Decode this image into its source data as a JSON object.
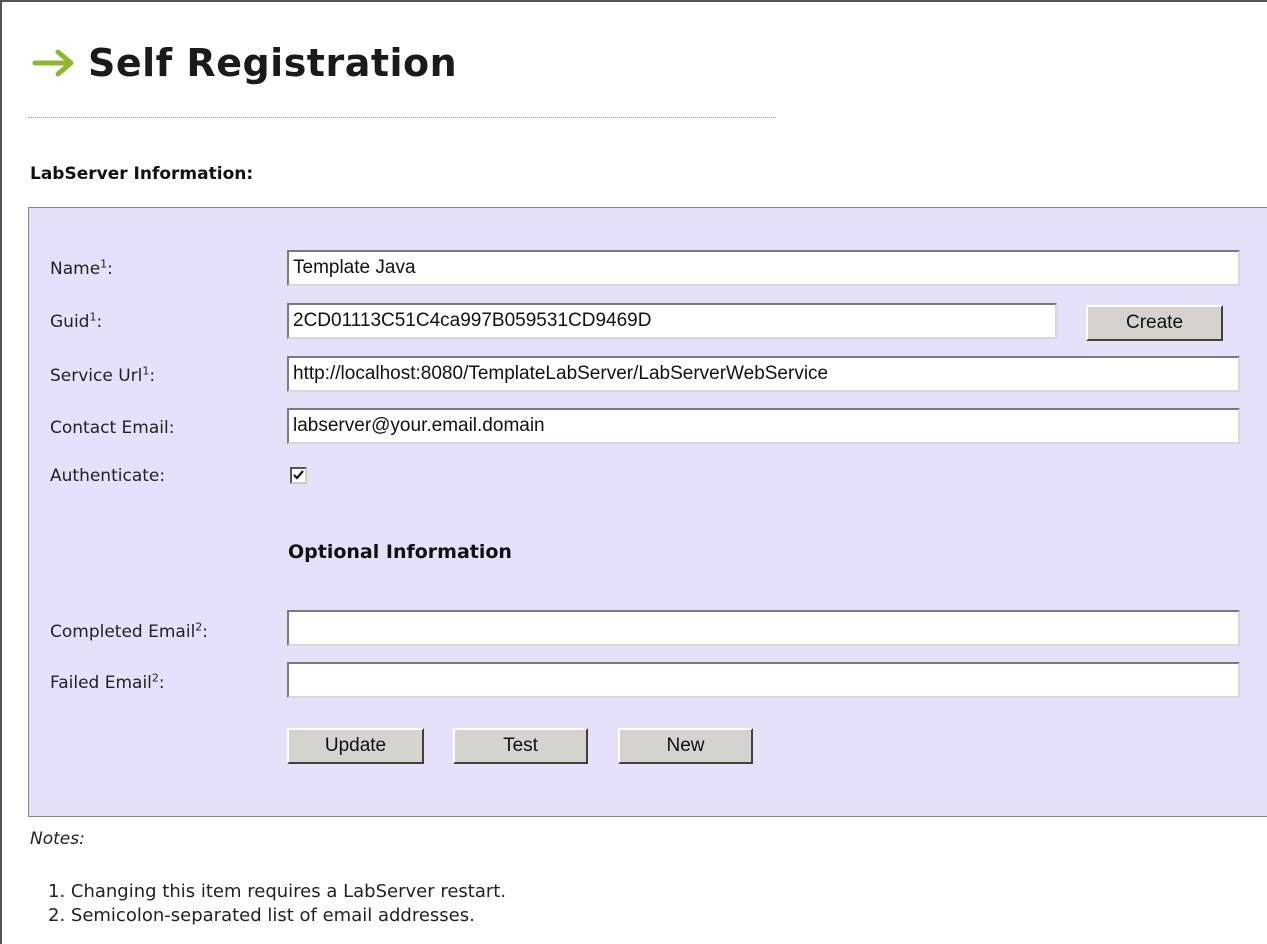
{
  "page": {
    "title": "Self Registration",
    "section_heading": "LabServer Information:"
  },
  "form": {
    "name": {
      "label": "Name",
      "sup": "1",
      "suffix": ":",
      "value": "Template Java"
    },
    "guid": {
      "label": "Guid",
      "sup": "1",
      "suffix": ":",
      "value": "2CD01113C51C4ca997B059531CD9469D",
      "create_label": "Create"
    },
    "service_url": {
      "label": "Service Url",
      "sup": "1",
      "suffix": ":",
      "value": "http://localhost:8080/TemplateLabServer/LabServerWebService"
    },
    "contact_email": {
      "label": "Contact Email:",
      "value": "labserver@your.email.domain"
    },
    "authenticate": {
      "label": "Authenticate:",
      "checked": true
    },
    "optional_heading": "Optional Information",
    "completed_email": {
      "label": "Completed Email",
      "sup": "2",
      "suffix": ":",
      "value": ""
    },
    "failed_email": {
      "label": "Failed Email",
      "sup": "2",
      "suffix": ":",
      "value": ""
    },
    "buttons": {
      "update": "Update",
      "test": "Test",
      "new": "New"
    }
  },
  "notes": {
    "title": "Notes:",
    "items": [
      "1. Changing this item requires a LabServer restart.",
      "2. Semicolon-separated list of email addresses."
    ]
  },
  "colors": {
    "panel_bg": "#e6e1fa",
    "arrow": "#8cb833",
    "button_bg": "#d6d3ce"
  },
  "icons": {
    "title_arrow": "right-arrow-icon",
    "check": "checkmark-icon"
  }
}
